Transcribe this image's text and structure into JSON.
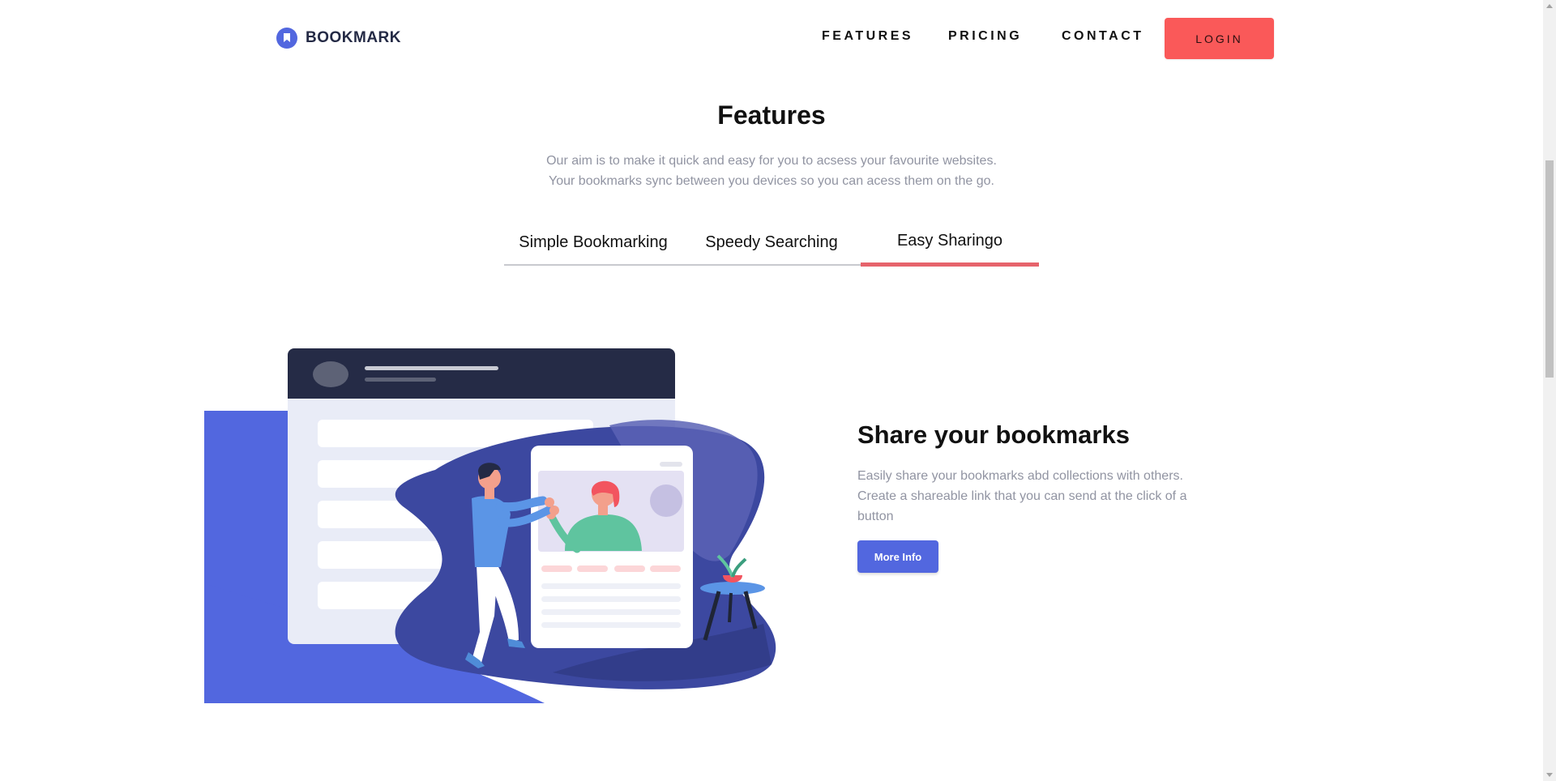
{
  "brand": {
    "name": "BOOKMARK",
    "logo_icon": "bookmark-icon",
    "accent": "#5267df"
  },
  "nav": {
    "links": [
      "FEATURES",
      "PRICING",
      "CONTACT"
    ],
    "login_label": "LOGIN",
    "login_color": "#fa5959"
  },
  "section": {
    "title": "Features",
    "description": "Our aim is to make it quick and easy for you to acsess your favourite websites. Your bookmarks sync between you devices so you can acess them on the go."
  },
  "tabs": {
    "items": [
      "Simple Bookmarking",
      "Speedy Searching",
      "Easy Sharingo"
    ],
    "active_index": 2,
    "active_color": "#e6636b"
  },
  "feature": {
    "title": "Share your bookmarks",
    "description": "Easily share your bookmarks abd collections with others. Create a shareable link that you can send at the click of a button",
    "button_label": "More Info",
    "button_color": "#5267df"
  }
}
